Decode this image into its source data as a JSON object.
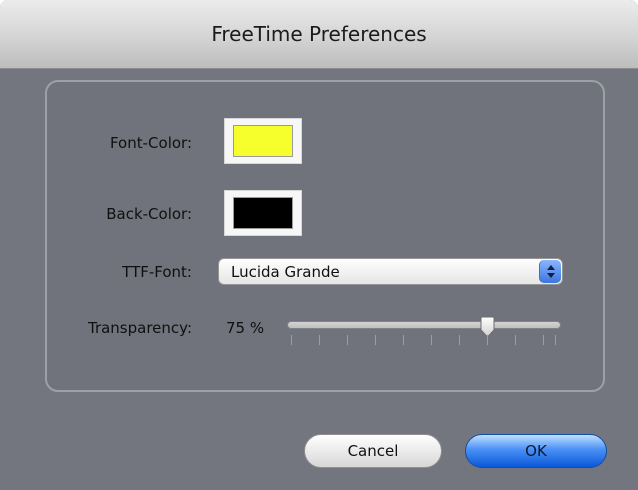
{
  "window": {
    "title": "FreeTime Preferences"
  },
  "fields": {
    "font_color": {
      "label": "Font-Color:",
      "color": "#f6ff2b"
    },
    "back_color": {
      "label": "Back-Color:",
      "color": "#000000"
    },
    "ttf_font": {
      "label": "TTF-Font:",
      "value": "Lucida Grande"
    },
    "transparency": {
      "label": "Transparency:",
      "value_text": "75 %",
      "value_percent": 75
    }
  },
  "buttons": {
    "cancel": "Cancel",
    "ok": "OK"
  }
}
